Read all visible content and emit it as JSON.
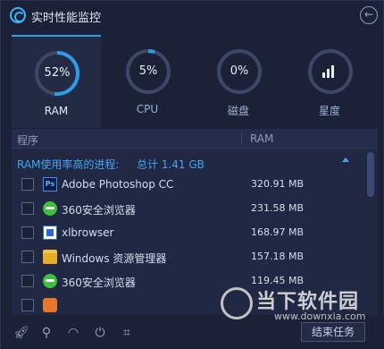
{
  "window": {
    "title": "实时性能监控",
    "back_icon": "back-arrow-icon"
  },
  "tabs": [
    {
      "label": "RAM",
      "value": "52%",
      "percent": 52,
      "active": true
    },
    {
      "label": "CPU",
      "value": "5%",
      "percent": 5,
      "active": false
    },
    {
      "label": "磁盘",
      "value": "0%",
      "percent": 0,
      "active": false
    },
    {
      "label": "星度",
      "icon": "bar-chart-icon",
      "active": false
    }
  ],
  "colors": {
    "accent": "#2f9be8",
    "ring_track": "#3e4764",
    "group_text": "#46a4f0"
  },
  "table": {
    "headers": {
      "process": "程序",
      "ram": "RAM"
    },
    "group": {
      "label": "RAM使用率高的进程:",
      "total": "总计 1.41 GB"
    },
    "rows": [
      {
        "name": "Adobe Photoshop CC",
        "memory": "320.91 MB",
        "icon": "photoshop-icon"
      },
      {
        "name": "360安全浏览器",
        "memory": "231.58 MB",
        "icon": "browser-360-icon"
      },
      {
        "name": "xlbrowser",
        "memory": "168.97 MB",
        "icon": "xlbrowser-icon"
      },
      {
        "name": "Windows 资源管理器",
        "memory": "157.18 MB",
        "icon": "folder-icon"
      },
      {
        "name": "360安全浏览器",
        "memory": "119.45 MB",
        "icon": "browser-360-icon"
      },
      {
        "name": "",
        "memory": "",
        "icon": "app-icon"
      }
    ]
  },
  "toolbar": {
    "end_task_label": "结束任务",
    "icons": [
      "rocket-icon",
      "search-icon",
      "speed-icon",
      "power-icon",
      "crop-icon"
    ]
  },
  "watermark": {
    "title": "当下软件园",
    "url": "www.downxia.com"
  }
}
